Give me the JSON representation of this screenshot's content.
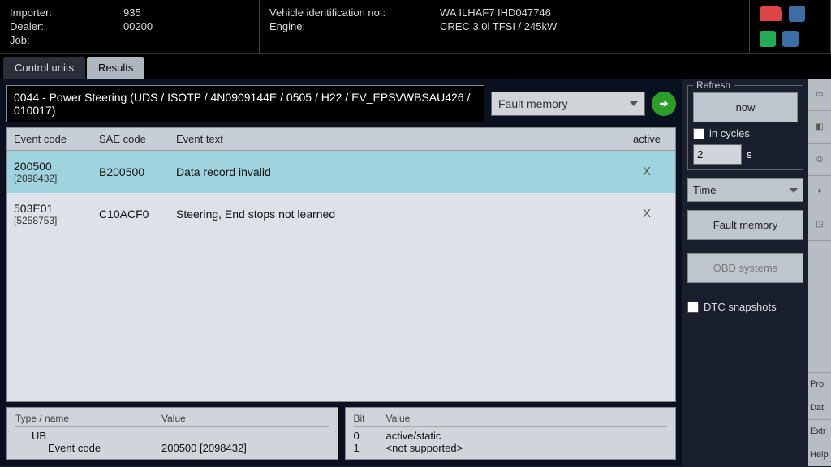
{
  "header": {
    "importer_label": "Importer:",
    "importer": "935",
    "dealer_label": "Dealer:",
    "dealer": "00200",
    "job_label": "Job:",
    "job": "---",
    "vin_label": "Vehicle identification no.:",
    "vin": "WA ILHAF7 IHD047746",
    "engine_label": "Engine:",
    "engine": "CREC 3,0l TFSI / 245kW"
  },
  "tabs": {
    "t0": "Control units",
    "t1": "Results"
  },
  "module_line": "0044 - Power Steering  (UDS / ISOTP / 4N0909144E / 0505 / H22 / EV_EPSVWBSAU426 / 010017)",
  "mode_select": "Fault memory",
  "table": {
    "h_ec": "Event code",
    "h_sae": "SAE code",
    "h_txt": "Event text",
    "h_act": "active",
    "rows": [
      {
        "ec": "200500",
        "ec2": "[2098432]",
        "sae": "B200500",
        "txt": "Data record invalid",
        "x": "X"
      },
      {
        "ec": "503E01",
        "ec2": "[5258753]",
        "sae": "C10ACF0",
        "txt": "Steering, End stops not learned",
        "x": "X"
      }
    ]
  },
  "detail_left": {
    "h1": "Type / name",
    "h2": "Value",
    "r1a": "UB",
    "r2a": "Event code",
    "r2b": "200500 [2098432]"
  },
  "detail_right": {
    "h1": "Bit",
    "h2": "Value",
    "r1a": "0",
    "r1b": "active/static",
    "r2a": "1",
    "r2b": "<not supported>"
  },
  "sidebar": {
    "refresh_label": "Refresh",
    "now": "now",
    "in_cycles": "in cycles",
    "cycles_val": "2",
    "s_suffix": "s",
    "time_sel": "Time",
    "fault_memory": "Fault memory",
    "obd": "OBD systems",
    "dtc_snap": "DTC snapshots"
  },
  "farright": {
    "b0": "Pro",
    "b1": "Dat",
    "b2": "Extr",
    "b3": "Help"
  }
}
